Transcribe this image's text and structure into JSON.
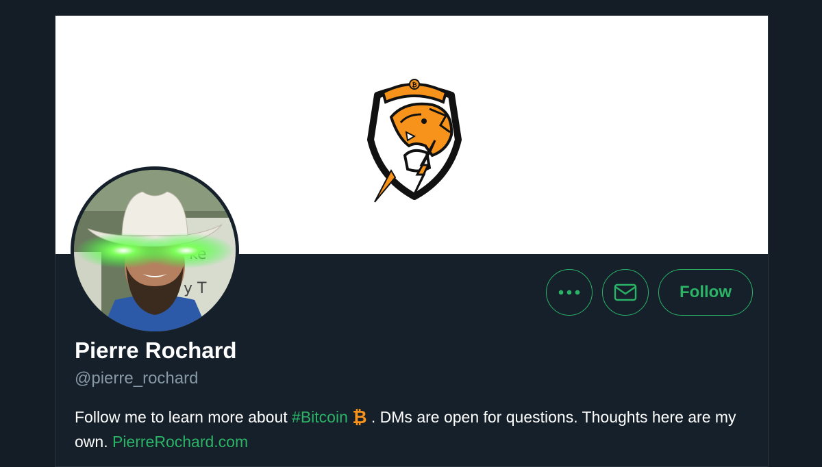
{
  "profile": {
    "display_name": "Pierre Rochard",
    "handle": "@pierre_rochard",
    "bio": {
      "part1": "Follow me to learn more about ",
      "hashtag": "#Bitcoin",
      "emoji_icon": "bitcoin-emoji-icon",
      "part2": ". DMs are open for questions. Thoughts here are my own. ",
      "website": "PierreRochard.com"
    }
  },
  "actions": {
    "more_icon": "more-dots-icon",
    "message_icon": "envelope-icon",
    "follow_label": "Follow"
  },
  "banner": {
    "logo_icon": "honey-badger-bitcoin-shield-logo"
  },
  "colors": {
    "accent": "#2bb366",
    "background": "#15202b",
    "outer_background": "#141d26",
    "secondary_text": "#8899a6",
    "bitcoin_orange": "#f7931a"
  }
}
